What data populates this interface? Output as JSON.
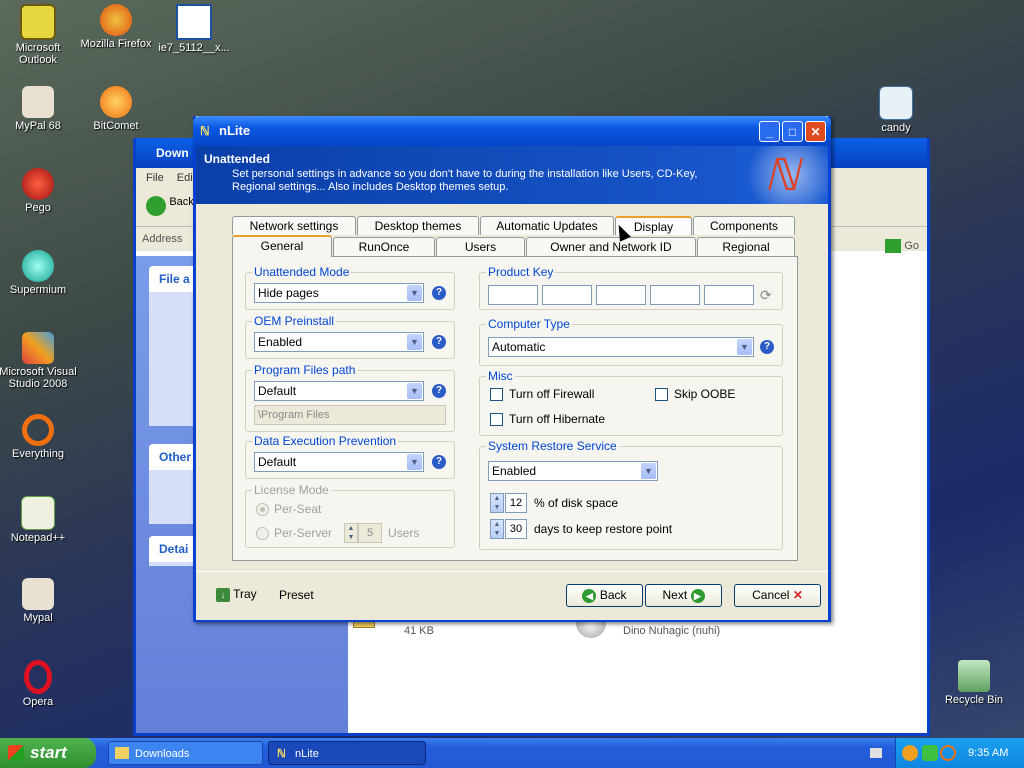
{
  "desktop": {
    "icons_left": [
      {
        "label": "Microsoft Outlook",
        "icon": "outlook-icon"
      },
      {
        "label": "MyPal 68",
        "icon": "mypal-icon"
      },
      {
        "label": "Pego",
        "icon": "pego-icon"
      },
      {
        "label": "Supermium",
        "icon": "supermium-icon"
      },
      {
        "label": "Microsoft Visual Studio 2008",
        "icon": "visual-studio-icon"
      },
      {
        "label": "Everything",
        "icon": "everything-icon"
      },
      {
        "label": "Notepad++",
        "icon": "notepadpp-icon"
      },
      {
        "label": "Mypal",
        "icon": "mypal-icon"
      },
      {
        "label": "Opera",
        "icon": "opera-icon"
      }
    ],
    "icon_firefox": "Mozilla Firefox",
    "icon_bitcomet": "BitComet",
    "icon_ie7": "ie7_5112__x...",
    "icon_candy": "candy",
    "icon_recycle": "Recycle Bin"
  },
  "background_window": {
    "title": "Down",
    "menu_file": "File",
    "menu_edit": "Edi",
    "back": "Back",
    "address_label": "Address",
    "go": "Go",
    "panel_file": "File a",
    "panel_other": "Other",
    "panel_details": "Detai",
    "file_size": "41 KB",
    "file_author": "Dino Nuhagic (nuhi)"
  },
  "nlite": {
    "title": "nLite",
    "header_title": "Unattended",
    "header_desc": "Set personal settings in advance so you don't have to during the installation like Users, CD-Key, Regional settings... Also includes Desktop themes setup.",
    "tabs_row1": [
      "Network settings",
      "Desktop themes",
      "Automatic Updates",
      "Display",
      "Components"
    ],
    "tabs_row2": [
      "General",
      "RunOnce",
      "Users",
      "Owner and Network ID",
      "Regional"
    ],
    "unattended_mode": {
      "legend": "Unattended Mode",
      "value": "Hide pages"
    },
    "oem_preinstall": {
      "legend": "OEM Preinstall",
      "value": "Enabled"
    },
    "program_files": {
      "legend": "Program Files path",
      "value": "Default",
      "path": "\\Program Files"
    },
    "dep": {
      "legend": "Data Execution Prevention",
      "value": "Default"
    },
    "license": {
      "legend": "License Mode",
      "per_seat": "Per-Seat",
      "per_server": "Per-Server",
      "users_value": "5",
      "users_label": "Users"
    },
    "product_key": {
      "legend": "Product Key"
    },
    "computer_type": {
      "legend": "Computer Type",
      "value": "Automatic"
    },
    "misc": {
      "legend": "Misc",
      "firewall": "Turn off Firewall",
      "skip_oobe": "Skip OOBE",
      "hibernate": "Turn off Hibernate"
    },
    "restore": {
      "legend": "System Restore Service",
      "value": "Enabled",
      "disk_value": "12",
      "disk_label": "% of disk space",
      "days_value": "30",
      "days_label": "days to keep restore point"
    },
    "footer": {
      "tray": "Tray",
      "preset": "Preset",
      "back": "Back",
      "next": "Next",
      "cancel": "Cancel"
    }
  },
  "taskbar": {
    "start": "start",
    "tasks": [
      "Downloads",
      "nLite"
    ],
    "clock": "9:35 AM"
  }
}
